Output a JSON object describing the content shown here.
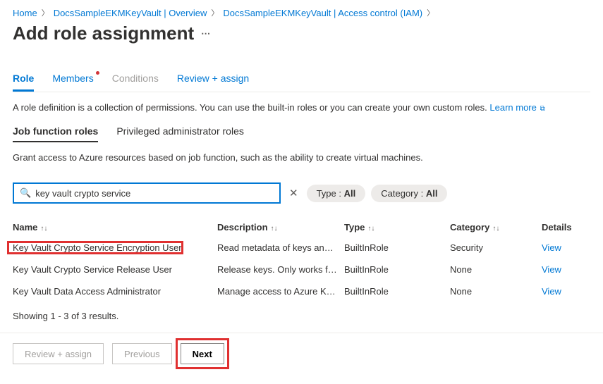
{
  "breadcrumb": {
    "home": "Home",
    "item1": "DocsSampleEKMKeyVault | Overview",
    "item2": "DocsSampleEKMKeyVault | Access control (IAM)"
  },
  "page_title": "Add role assignment",
  "tabs1": {
    "role": "Role",
    "members": "Members",
    "conditions": "Conditions",
    "review": "Review + assign"
  },
  "role_desc": "A role definition is a collection of permissions. You can use the built-in roles or you can create your own custom roles.",
  "learn_more": "Learn more",
  "tabs2": {
    "job": "Job function roles",
    "priv": "Privileged administrator roles"
  },
  "job_desc": "Grant access to Azure resources based on job function, such as the ability to create virtual machines.",
  "search": {
    "value": "key vault crypto service"
  },
  "filters": {
    "type_label": "Type :",
    "type_value": "All",
    "cat_label": "Category :",
    "cat_value": "All"
  },
  "columns": {
    "name": "Name",
    "desc": "Description",
    "type": "Type",
    "cat": "Category",
    "details": "Details"
  },
  "rows": [
    {
      "name": "Key Vault Crypto Service Encryption User",
      "desc": "Read metadata of keys and p…",
      "type": "BuiltInRole",
      "cat": "Security",
      "view": "View"
    },
    {
      "name": "Key Vault Crypto Service Release User",
      "desc": "Release keys. Only works for …",
      "type": "BuiltInRole",
      "cat": "None",
      "view": "View"
    },
    {
      "name": "Key Vault Data Access Administrator",
      "desc": "Manage access to Azure Key …",
      "type": "BuiltInRole",
      "cat": "None",
      "view": "View"
    }
  ],
  "results_note": "Showing 1 - 3 of 3 results.",
  "footer": {
    "review": "Review + assign",
    "prev": "Previous",
    "next": "Next"
  }
}
